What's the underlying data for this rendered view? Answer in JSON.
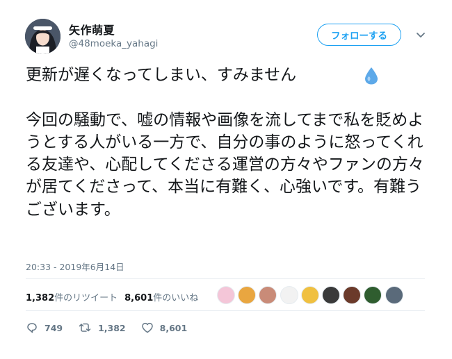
{
  "user": {
    "display_name": "矢作萌夏",
    "handle": "@48moeka_yahagi",
    "follow_label": "フォローする"
  },
  "tweet": {
    "text": "更新が遅くなってしまい、すみません\n\n今回の騒動で、嘘の情報や画像を流してまで私を貶めようとする人がいる一方で、自分の事のように怒ってくれる友達や、心配してくださる運営の方々やファンの方々が居てくださって、本当に有難く、心強いです。有難うございます。",
    "emoji": "droplet-icon",
    "timestamp": "20:33 - 2019年6月14日"
  },
  "stats": {
    "retweet_count": "1,382",
    "retweet_label": "件のリツイート",
    "like_count": "8,601",
    "like_label": "件のいいね"
  },
  "likers": {
    "colors": [
      "#f4c6d8",
      "#e9a640",
      "#c98b78",
      "#f2f2f2",
      "#f0c040",
      "#3a3a3a",
      "#6b3a2a",
      "#2f5d2f",
      "#5a6a7a"
    ]
  },
  "actions": {
    "reply_count": "749",
    "retweet_count": "1,382",
    "like_count": "8,601"
  },
  "colors": {
    "accent": "#1da1f2",
    "text": "#14171a",
    "muted": "#657786"
  }
}
